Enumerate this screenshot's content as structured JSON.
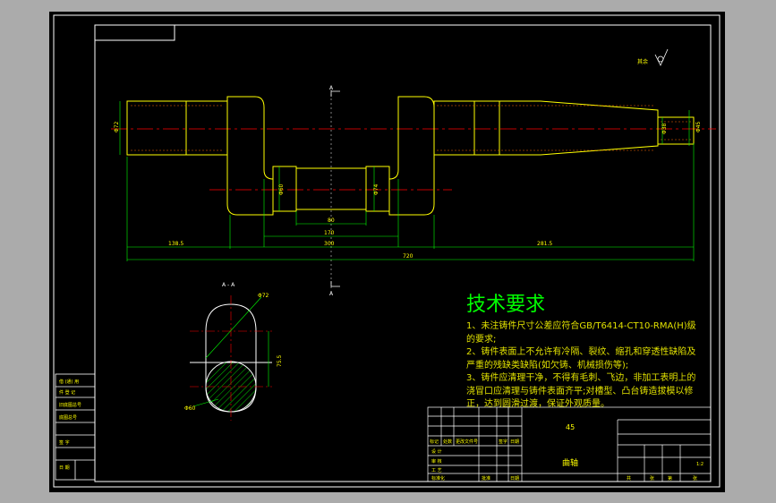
{
  "colors": {
    "frame": "#FFFFFF",
    "background": "#000000",
    "outer": "#ABABAB",
    "outline": "#FFFF00",
    "centerline": "#FF0000",
    "dimension": "#00FF00",
    "section": "#FFFFFF",
    "hatch": "#00FF00",
    "table_text": "#FFFF00",
    "title_green": "#00FF00"
  },
  "labels": {
    "roughness_note": "其余",
    "section_mark_top": "A",
    "section_mark_bottom": "A",
    "section_view": "A - A"
  },
  "dimensions": {
    "left_dia": "Φ72",
    "right_dia": "Φ38",
    "right_end": "Φ45",
    "crank_pin_dia": "Φ60",
    "pin_right": "Φ74",
    "pin_len": "80",
    "mid_len": "170",
    "span": "300",
    "left_len": "138.5",
    "right_len": "281.5",
    "total_len": "720",
    "section_top_dia": "Φ72",
    "section_offset": "75.5",
    "section_bottom_dia": "Φ60"
  },
  "notes": {
    "title": "技术要求",
    "lines": [
      "1、未注铸件尺寸公差应符合GB/T6414-CT10-RMA(H)级的要求;",
      "2、铸件表面上不允许有冷隔、裂纹、缩孔和穿透性缺陷及严重的残缺类缺陷(如欠铸、机械损伤等);",
      "3、铸件应清理干净，不得有毛刺、飞边，非加工表明上的浇冒口应清理与铸件表面齐平;对槽型、凸台铸造拔模以修正，达到圆滑过渡，保证外观质量。"
    ]
  },
  "title_block": {
    "part_name": "曲轴",
    "material": "45",
    "scale": "1:2",
    "left_rows": [
      "借 (通) 用",
      "件 登 记",
      "旧底图总号",
      "底图总号",
      "签 字",
      "日 期"
    ],
    "row_labels": [
      "标记",
      "处数",
      "更改文件号",
      "签字",
      "日期"
    ],
    "bottom_labels": [
      "设 计",
      "审 核",
      "工 艺",
      "标准化",
      "批准",
      "日期"
    ],
    "right_labels": [
      "共",
      "张",
      "第",
      "张"
    ]
  }
}
